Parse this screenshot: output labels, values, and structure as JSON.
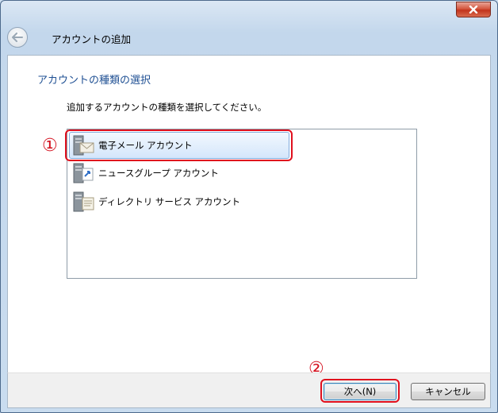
{
  "window": {
    "title": "",
    "heading": "アカウントの追加"
  },
  "page": {
    "section_title": "アカウントの種類の選択",
    "instruction": "追加するアカウントの種類を選択してください。"
  },
  "account_types": [
    {
      "label": "電子メール アカウント",
      "icon": "mail-server-icon",
      "selected": true
    },
    {
      "label": "ニュースグループ アカウント",
      "icon": "newsgroup-server-icon",
      "selected": false
    },
    {
      "label": "ディレクトリ サービス アカウント",
      "icon": "directory-server-icon",
      "selected": false
    }
  ],
  "annotations": {
    "step1": "①",
    "step2": "②"
  },
  "buttons": {
    "next": "次へ(N)",
    "cancel": "キャンセル"
  },
  "colors": {
    "annotation_red": "#e0101e",
    "section_title_blue": "#1e4f93"
  }
}
